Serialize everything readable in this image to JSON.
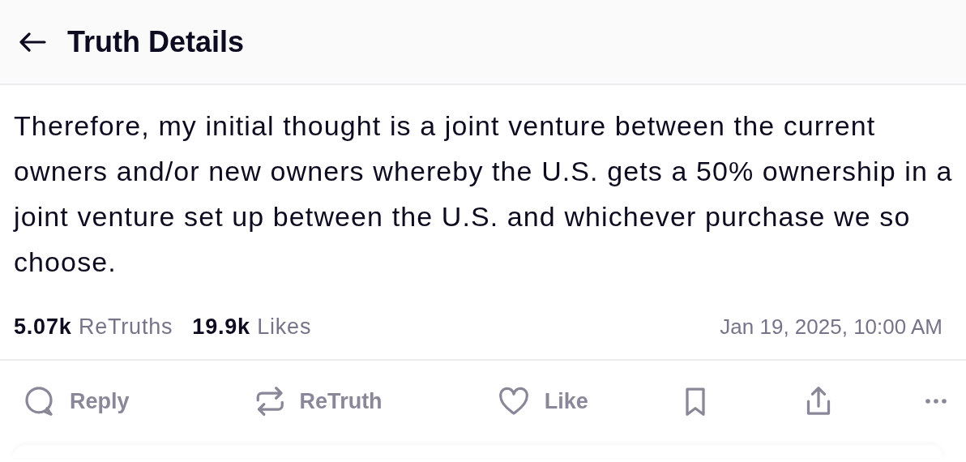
{
  "header": {
    "title": "Truth Details"
  },
  "post": {
    "text": "Therefore, my initial thought is a joint venture between the current owners and/or new owners whereby the U.S. gets a 50% ownership in a joint venture set up between the U.S. and whichever purchase we so choose."
  },
  "stats": [
    {
      "count": "5.07k",
      "label": "ReTruths"
    },
    {
      "count": "19.9k",
      "label": "Likes"
    }
  ],
  "timestamp": "Jan 19, 2025, 10:00 AM",
  "actions": [
    {
      "kind": "reply",
      "label": "Reply"
    },
    {
      "kind": "retruth",
      "label": "ReTruth"
    },
    {
      "kind": "like",
      "label": "Like"
    },
    {
      "kind": "bookmark"
    },
    {
      "kind": "share"
    },
    {
      "kind": "more"
    }
  ]
}
